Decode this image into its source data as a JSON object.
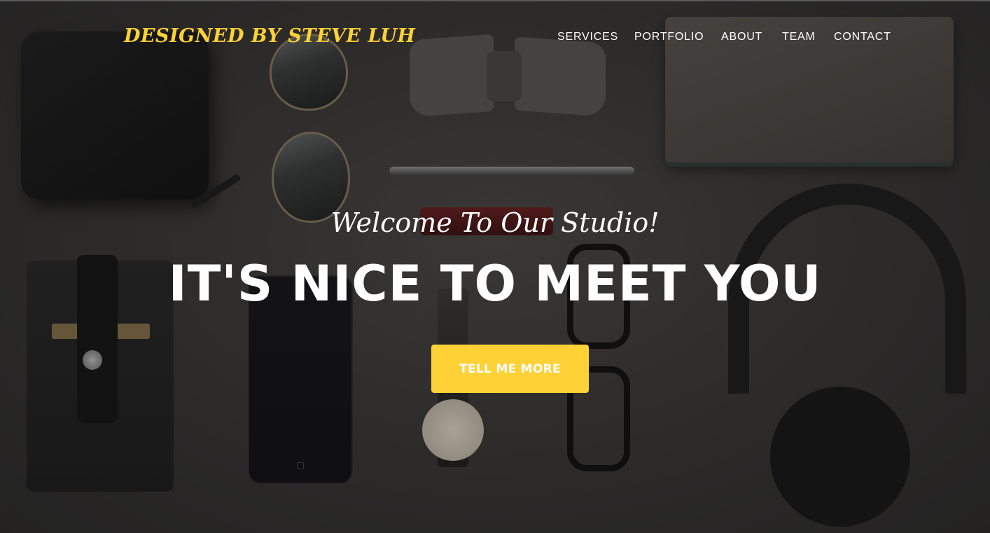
{
  "brand": {
    "name": "DESIGNED BY STEVE LUH",
    "color": "#fed136"
  },
  "nav": {
    "items": [
      {
        "label": "SERVICES"
      },
      {
        "label": "PORTFOLIO"
      },
      {
        "label": "ABOUT"
      },
      {
        "label": "TEAM"
      },
      {
        "label": "CONTACT"
      }
    ]
  },
  "hero": {
    "lead": "Welcome To Our Studio!",
    "heading": "IT'S NICE TO MEET YOU",
    "cta_label": "TELL ME MORE",
    "accent_color": "#fed136"
  }
}
